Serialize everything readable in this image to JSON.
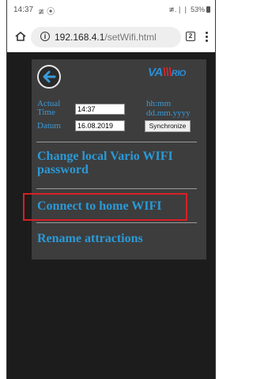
{
  "status_bar": {
    "time": "14:37",
    "left_icons": "≇ ⦿",
    "right_text": "≇.❘❘ 53%"
  },
  "browser": {
    "url_host": "192.168.4.1",
    "url_path": "/setWifi.html",
    "tab_count": "2"
  },
  "panel": {
    "logo_va": "VA",
    "logo_bars": "\\\\\\",
    "logo_rio": "RIO",
    "actual_time_label": "Actual\nTime",
    "time_value": "14:37",
    "time_format": "hh:mm",
    "datum_label": "Datum",
    "date_value": "16.08.2019",
    "date_format": "dd.mm.yyyy",
    "synchronize_label": "Synchronize",
    "change_password_label": "Change local Vario WIFI\npassword",
    "connect_wifi_label": "Connect to home WIFI",
    "rename_label": "Rename attractions"
  },
  "colors": {
    "accent_blue": "#2a9ad8",
    "logo_red": "#d9252b",
    "highlight_red": "#d81f26",
    "panel_bg": "#3d3d3d",
    "page_bg": "#1c1c1c"
  }
}
